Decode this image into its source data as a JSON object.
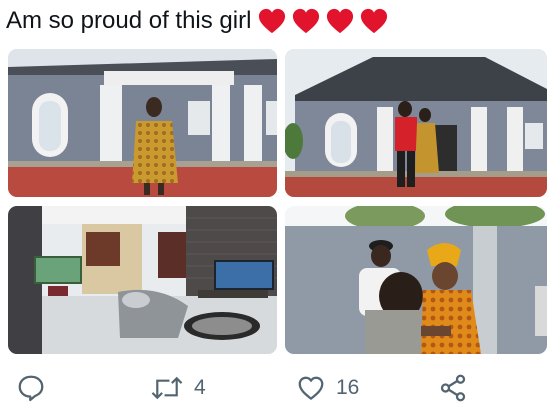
{
  "post": {
    "caption": "Am so proud of this girl",
    "hearts": [
      "heart-emoji",
      "heart-emoji",
      "heart-emoji",
      "heart-emoji"
    ],
    "heart_color": "#e2142d"
  },
  "media": [
    {
      "label": "photo-girl-in-front-of-house"
    },
    {
      "label": "photo-couple-hugging-in-front-of-house"
    },
    {
      "label": "photo-living-room-interior"
    },
    {
      "label": "photo-family-embrace-outdoors"
    }
  ],
  "actions": {
    "reply": {
      "icon": "reply-icon",
      "count": ""
    },
    "retweet": {
      "icon": "retweet-icon",
      "count": "4"
    },
    "like": {
      "icon": "like-icon",
      "count": "16"
    },
    "share": {
      "icon": "share-icon",
      "count": ""
    }
  },
  "colors": {
    "text": "#0f1419",
    "muted": "#536471"
  }
}
